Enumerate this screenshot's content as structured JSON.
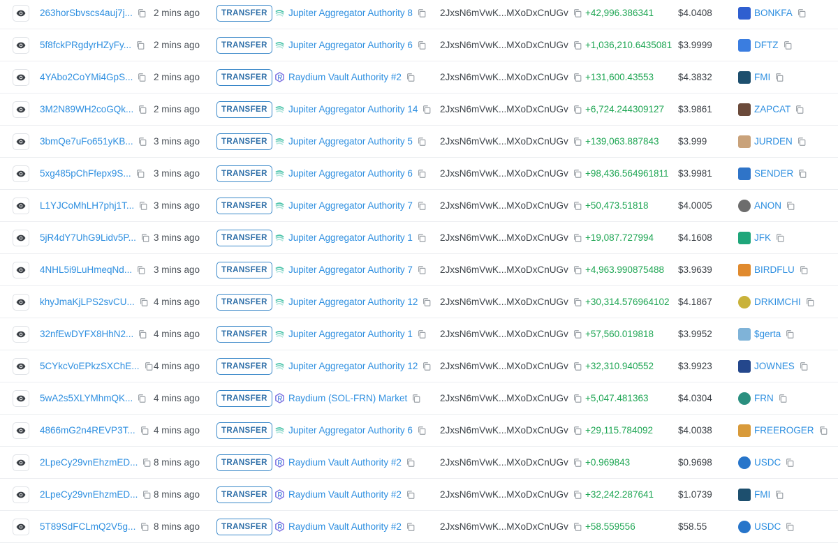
{
  "columns_badge_label": "TRANSFER",
  "colors": {
    "link": "#2e8fe0",
    "amount": "#1fa654",
    "badge_border": "#3a88c9"
  },
  "rows": [
    {
      "signature": "263horSbvscs4auj7j...",
      "time": "2 mins ago",
      "type": "TRANSFER",
      "from": "Jupiter Aggregator Authority 8",
      "from_kind": "jupiter",
      "to": "2JxsN6mVwK...MXoDxCnUGv",
      "amount": "+42,996.386341",
      "price": "$4.0408",
      "token": "BONKFA",
      "token_icon": "#2f5fd0",
      "token_icon_round": false
    },
    {
      "signature": "5f8fckPRgdyrHZyFy...",
      "time": "2 mins ago",
      "type": "TRANSFER",
      "from": "Jupiter Aggregator Authority 6",
      "from_kind": "jupiter",
      "to": "2JxsN6mVwK...MXoDxCnUGv",
      "amount": "+1,036,210.6435081",
      "price": "$3.9999",
      "token": "DFTZ",
      "token_icon": "#3a7de0",
      "token_icon_round": false
    },
    {
      "signature": "4YAbo2CoYMi4GpS...",
      "time": "2 mins ago",
      "type": "TRANSFER",
      "from": "Raydium Vault Authority #2",
      "from_kind": "raydium",
      "to": "2JxsN6mVwK...MXoDxCnUGv",
      "amount": "+131,600.43553",
      "price": "$4.3832",
      "token": "FMI",
      "token_icon": "#1d4f6e",
      "token_icon_round": false
    },
    {
      "signature": "3M2N89WH2coGQk...",
      "time": "2 mins ago",
      "type": "TRANSFER",
      "from": "Jupiter Aggregator Authority 14",
      "from_kind": "jupiter",
      "to": "2JxsN6mVwK...MXoDxCnUGv",
      "amount": "+6,724.244309127",
      "price": "$3.9861",
      "token": "ZAPCAT",
      "token_icon": "#6b4a3a",
      "token_icon_round": false
    },
    {
      "signature": "3bmQe7uFo651yKB...",
      "time": "3 mins ago",
      "type": "TRANSFER",
      "from": "Jupiter Aggregator Authority 5",
      "from_kind": "jupiter",
      "to": "2JxsN6mVwK...MXoDxCnUGv",
      "amount": "+139,063.887843",
      "price": "$3.999",
      "token": "JURDEN",
      "token_icon": "#c9a27a",
      "token_icon_round": false
    },
    {
      "signature": "5xg485pChFfepx9S...",
      "time": "3 mins ago",
      "type": "TRANSFER",
      "from": "Jupiter Aggregator Authority 6",
      "from_kind": "jupiter",
      "to": "2JxsN6mVwK...MXoDxCnUGv",
      "amount": "+98,436.564961811",
      "price": "$3.9981",
      "token": "SENDER",
      "token_icon": "#2f74c8",
      "token_icon_round": false
    },
    {
      "signature": "L1YJCoMhLH7phj1T...",
      "time": "3 mins ago",
      "type": "TRANSFER",
      "from": "Jupiter Aggregator Authority 7",
      "from_kind": "jupiter",
      "to": "2JxsN6mVwK...MXoDxCnUGv",
      "amount": "+50,473.51818",
      "price": "$4.0005",
      "token": "ANON",
      "token_icon": "#6d6d6d",
      "token_icon_round": true
    },
    {
      "signature": "5jR4dY7UhG9Lidv5P...",
      "time": "3 mins ago",
      "type": "TRANSFER",
      "from": "Jupiter Aggregator Authority 1",
      "from_kind": "jupiter",
      "to": "2JxsN6mVwK...MXoDxCnUGv",
      "amount": "+19,087.727994",
      "price": "$4.1608",
      "token": "JFK",
      "token_icon": "#1fa67a",
      "token_icon_round": false
    },
    {
      "signature": "4NHL5i9LuHmeqNd...",
      "time": "3 mins ago",
      "type": "TRANSFER",
      "from": "Jupiter Aggregator Authority 7",
      "from_kind": "jupiter",
      "to": "2JxsN6mVwK...MXoDxCnUGv",
      "amount": "+4,963.990875488",
      "price": "$3.9639",
      "token": "BIRDFLU",
      "token_icon": "#e08a2e",
      "token_icon_round": false
    },
    {
      "signature": "khyJmaKjLPS2svCU...",
      "time": "4 mins ago",
      "type": "TRANSFER",
      "from": "Jupiter Aggregator Authority 12",
      "from_kind": "jupiter",
      "to": "2JxsN6mVwK...MXoDxCnUGv",
      "amount": "+30,314.576964102",
      "price": "$4.1867",
      "token": "DRKIMCHI",
      "token_icon": "#c9b23a",
      "token_icon_round": true
    },
    {
      "signature": "32nfEwDYFX8HhN2...",
      "time": "4 mins ago",
      "type": "TRANSFER",
      "from": "Jupiter Aggregator Authority 1",
      "from_kind": "jupiter",
      "to": "2JxsN6mVwK...MXoDxCnUGv",
      "amount": "+57,560.019818",
      "price": "$3.9952",
      "token": "$gerta",
      "token_icon": "#7fb3d8",
      "token_icon_round": false
    },
    {
      "signature": "5CYkcVoEPkzSXChE...",
      "time": "4 mins ago",
      "type": "TRANSFER",
      "from": "Jupiter Aggregator Authority 12",
      "from_kind": "jupiter",
      "to": "2JxsN6mVwK...MXoDxCnUGv",
      "amount": "+32,310.940552",
      "price": "$3.9923",
      "token": "JOWNES",
      "token_icon": "#24478c",
      "token_icon_round": false
    },
    {
      "signature": "5wA2s5XLYMhmQK...",
      "time": "4 mins ago",
      "type": "TRANSFER",
      "from": "Raydium (SOL-FRN) Market",
      "from_kind": "raydium",
      "to": "2JxsN6mVwK...MXoDxCnUGv",
      "amount": "+5,047.481363",
      "price": "$4.0304",
      "token": "FRN",
      "token_icon": "#2a8f7f",
      "token_icon_round": true
    },
    {
      "signature": "4866mG2n4REVP3T...",
      "time": "4 mins ago",
      "type": "TRANSFER",
      "from": "Jupiter Aggregator Authority 6",
      "from_kind": "jupiter",
      "to": "2JxsN6mVwK...MXoDxCnUGv",
      "amount": "+29,115.784092",
      "price": "$4.0038",
      "token": "FREEROGER",
      "token_icon": "#d89a3a",
      "token_icon_round": false
    },
    {
      "signature": "2LpeCy29vnEhzmED...",
      "time": "8 mins ago",
      "type": "TRANSFER",
      "from": "Raydium Vault Authority #2",
      "from_kind": "raydium",
      "to": "2JxsN6mVwK...MXoDxCnUGv",
      "amount": "+0.969843",
      "price": "$0.9698",
      "token": "USDC",
      "token_icon": "#2775ca",
      "token_icon_round": true
    },
    {
      "signature": "2LpeCy29vnEhzmED...",
      "time": "8 mins ago",
      "type": "TRANSFER",
      "from": "Raydium Vault Authority #2",
      "from_kind": "raydium",
      "to": "2JxsN6mVwK...MXoDxCnUGv",
      "amount": "+32,242.287641",
      "price": "$1.0739",
      "token": "FMI",
      "token_icon": "#1d4f6e",
      "token_icon_round": false
    },
    {
      "signature": "5T89SdFCLmQ2V5g...",
      "time": "8 mins ago",
      "type": "TRANSFER",
      "from": "Raydium Vault Authority #2",
      "from_kind": "raydium",
      "to": "2JxsN6mVwK...MXoDxCnUGv",
      "amount": "+58.559556",
      "price": "$58.55",
      "token": "USDC",
      "token_icon": "#2775ca",
      "token_icon_round": true
    }
  ]
}
